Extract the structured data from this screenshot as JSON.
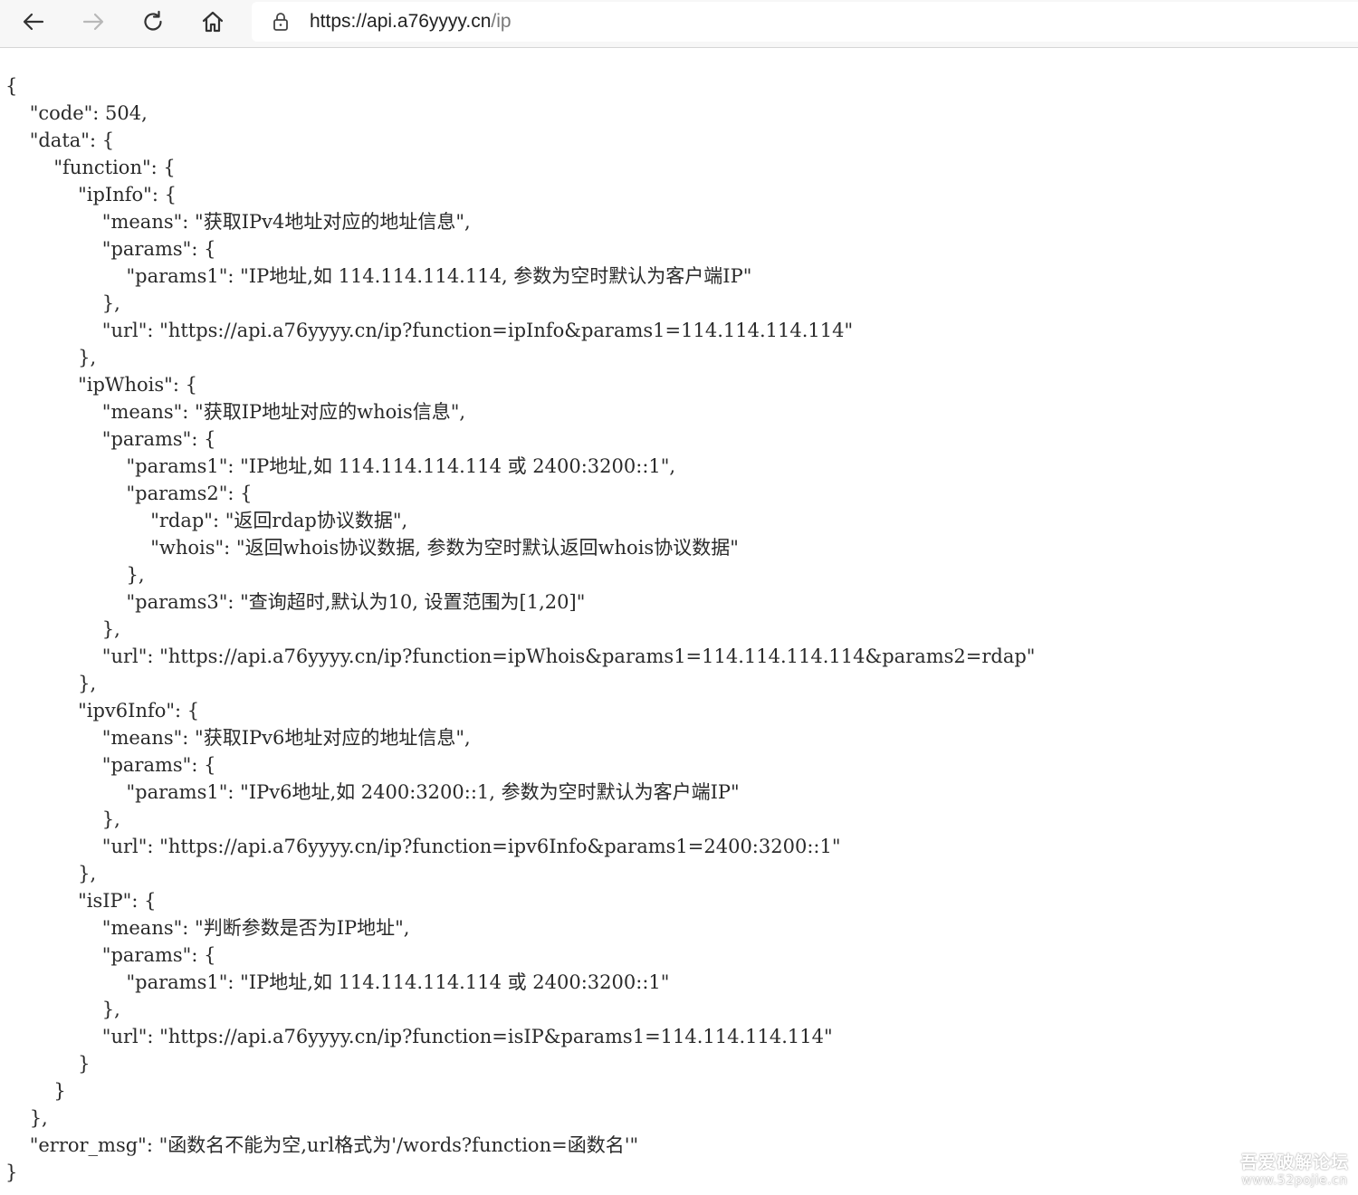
{
  "browser": {
    "url_host": "https://api.a76yyyy.cn",
    "url_path": "/ip",
    "icons": {
      "back": "arrow-left-icon",
      "forward": "arrow-right-icon",
      "reload": "reload-icon",
      "home": "home-icon",
      "security": "lock-icon"
    }
  },
  "json_lines": [
    "{",
    "    \"code\": 504,",
    "    \"data\": {",
    "        \"function\": {",
    "            \"ipInfo\": {",
    "                \"means\": \"获取IPv4地址对应的地址信息\",",
    "                \"params\": {",
    "                    \"params1\": \"IP地址,如 114.114.114.114, 参数为空时默认为客户端IP\"",
    "                },",
    "                \"url\": \"https://api.a76yyyy.cn/ip?function=ipInfo&params1=114.114.114.114\"",
    "            },",
    "            \"ipWhois\": {",
    "                \"means\": \"获取IP地址对应的whois信息\",",
    "                \"params\": {",
    "                    \"params1\": \"IP地址,如 114.114.114.114 或 2400:3200::1\",",
    "                    \"params2\": {",
    "                        \"rdap\": \"返回rdap协议数据\",",
    "                        \"whois\": \"返回whois协议数据, 参数为空时默认返回whois协议数据\"",
    "                    },",
    "                    \"params3\": \"查询超时,默认为10, 设置范围为[1,20]\"",
    "                },",
    "                \"url\": \"https://api.a76yyyy.cn/ip?function=ipWhois&params1=114.114.114.114&params2=rdap\"",
    "            },",
    "            \"ipv6Info\": {",
    "                \"means\": \"获取IPv6地址对应的地址信息\",",
    "                \"params\": {",
    "                    \"params1\": \"IPv6地址,如 2400:3200::1, 参数为空时默认为客户端IP\"",
    "                },",
    "                \"url\": \"https://api.a76yyyy.cn/ip?function=ipv6Info&params1=2400:3200::1\"",
    "            },",
    "            \"isIP\": {",
    "                \"means\": \"判断参数是否为IP地址\",",
    "                \"params\": {",
    "                    \"params1\": \"IP地址,如 114.114.114.114 或 2400:3200::1\"",
    "                },",
    "                \"url\": \"https://api.a76yyyy.cn/ip?function=isIP&params1=114.114.114.114\"",
    "            }",
    "        }",
    "    },",
    "    \"error_msg\": \"函数名不能为空,url格式为'/words?function=函数名'\"",
    "}"
  ],
  "watermark": {
    "line1": "吾爱破解论坛",
    "line2": "www.52pojie.cn"
  }
}
